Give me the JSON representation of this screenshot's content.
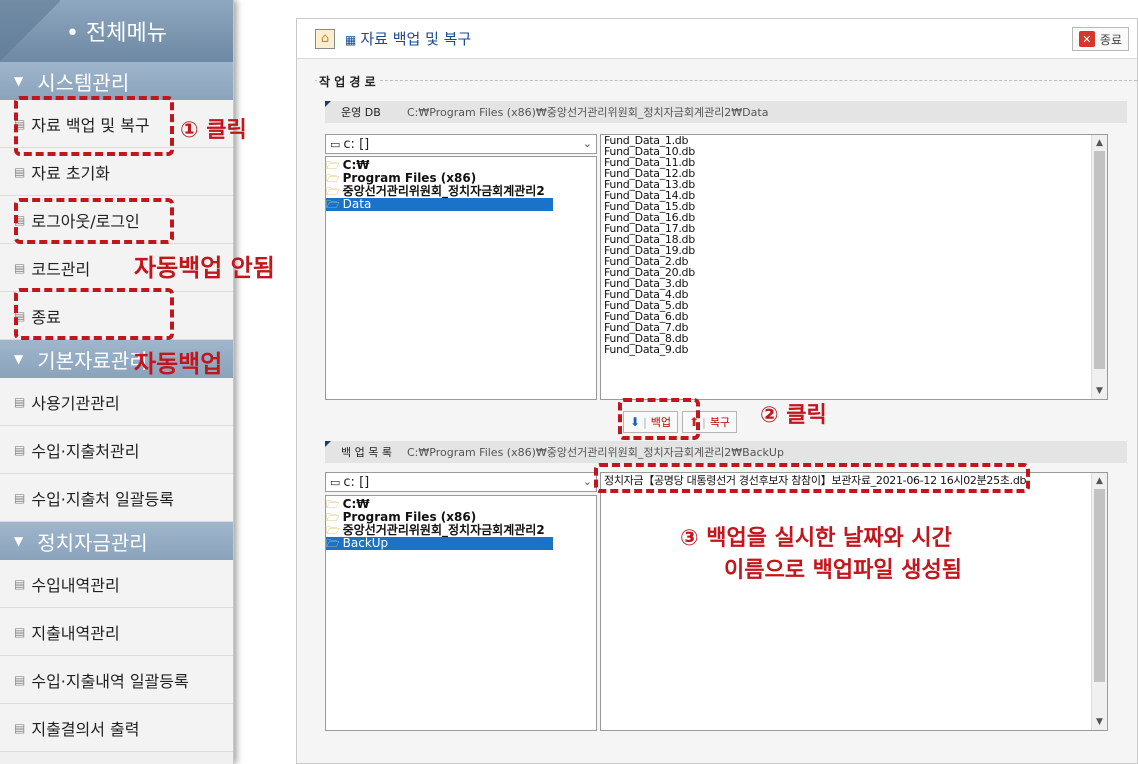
{
  "sidebar": {
    "header": "• 전체메뉴",
    "sections": [
      {
        "title": "시스템관리",
        "items": [
          "자료 백업 및 복구",
          "자료 초기화",
          "로그아웃/로그인",
          "코드관리",
          "종료"
        ]
      },
      {
        "title": "기본자료관리",
        "items": [
          "사용기관관리",
          "수입·지출처관리",
          "수입·지출처 일괄등록"
        ]
      },
      {
        "title": "정치자금관리",
        "items": [
          "수입내역관리",
          "지출내역관리",
          "수입·지출내역 일괄등록",
          "지출결의서 출력"
        ]
      }
    ]
  },
  "window": {
    "title": "자료 백업 및 복구",
    "close_label": "종료",
    "group_label": "작 업 경 로",
    "operating_db": {
      "tag": "운영 DB",
      "path": "C:₩Program Files (x86)₩중앙선거관리위원회_정치자금회계관리2₩Data",
      "drive": "c: []",
      "folders": [
        "C:₩",
        "Program Files (x86)",
        "중앙선거관리위원회_정치자금회계관리2",
        "Data"
      ],
      "files": [
        "Fund_Data_1.db",
        "Fund_Data_10.db",
        "Fund_Data_11.db",
        "Fund_Data_12.db",
        "Fund_Data_13.db",
        "Fund_Data_14.db",
        "Fund_Data_15.db",
        "Fund_Data_16.db",
        "Fund_Data_17.db",
        "Fund_Data_18.db",
        "Fund_Data_19.db",
        "Fund_Data_2.db",
        "Fund_Data_20.db",
        "Fund_Data_3.db",
        "Fund_Data_4.db",
        "Fund_Data_5.db",
        "Fund_Data_6.db",
        "Fund_Data_7.db",
        "Fund_Data_8.db",
        "Fund_Data_9.db"
      ]
    },
    "backup_label": "백업",
    "restore_label": "복구",
    "backup_list": {
      "tag": "백 업 목 록",
      "path": "C:₩Program Files (x86)₩중앙선거관리위원회_정치자금회계관리2₩BackUp",
      "drive": "c: []",
      "folders": [
        "C:₩",
        "Program Files (x86)",
        "중앙선거관리위원회_정치자금회계관리2",
        "BackUp"
      ],
      "files": [
        "정치자금【공명당 대통령선거 경선후보자 참참이】보관자료_2021-06-12 16시02분25초.db"
      ]
    }
  },
  "annotations": {
    "step1": "① 클릭",
    "no_auto_backup": "자동백업 안됨",
    "auto_backup": "자동백업",
    "step2": "② 클릭",
    "step3_line1": "③ 백업을 실시한 날짜와 시간",
    "step3_line2": "이름으로 백업파일 생성됨"
  },
  "colors": {
    "annotation": "#c2161c",
    "selection": "#1a73c9",
    "sidebar_section": "#8aa3bb"
  }
}
